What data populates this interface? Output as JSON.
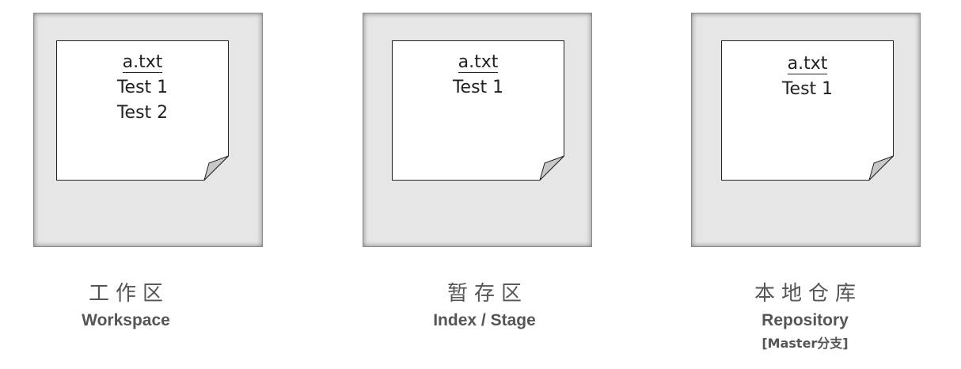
{
  "stages": [
    {
      "title_cn": "工作区",
      "title_en": "Workspace",
      "file": {
        "name": "a.txt",
        "lines": [
          "Test 1",
          "Test 2"
        ]
      }
    },
    {
      "title_cn": "暂存区",
      "title_en": "Index / Stage",
      "file": {
        "name": "a.txt",
        "lines": [
          "Test 1"
        ]
      }
    },
    {
      "title_cn": "本地仓库",
      "title_en": "Repository",
      "branch": "[Master分支]",
      "file": {
        "name": "a.txt",
        "lines": [
          "Test 1"
        ]
      }
    }
  ]
}
